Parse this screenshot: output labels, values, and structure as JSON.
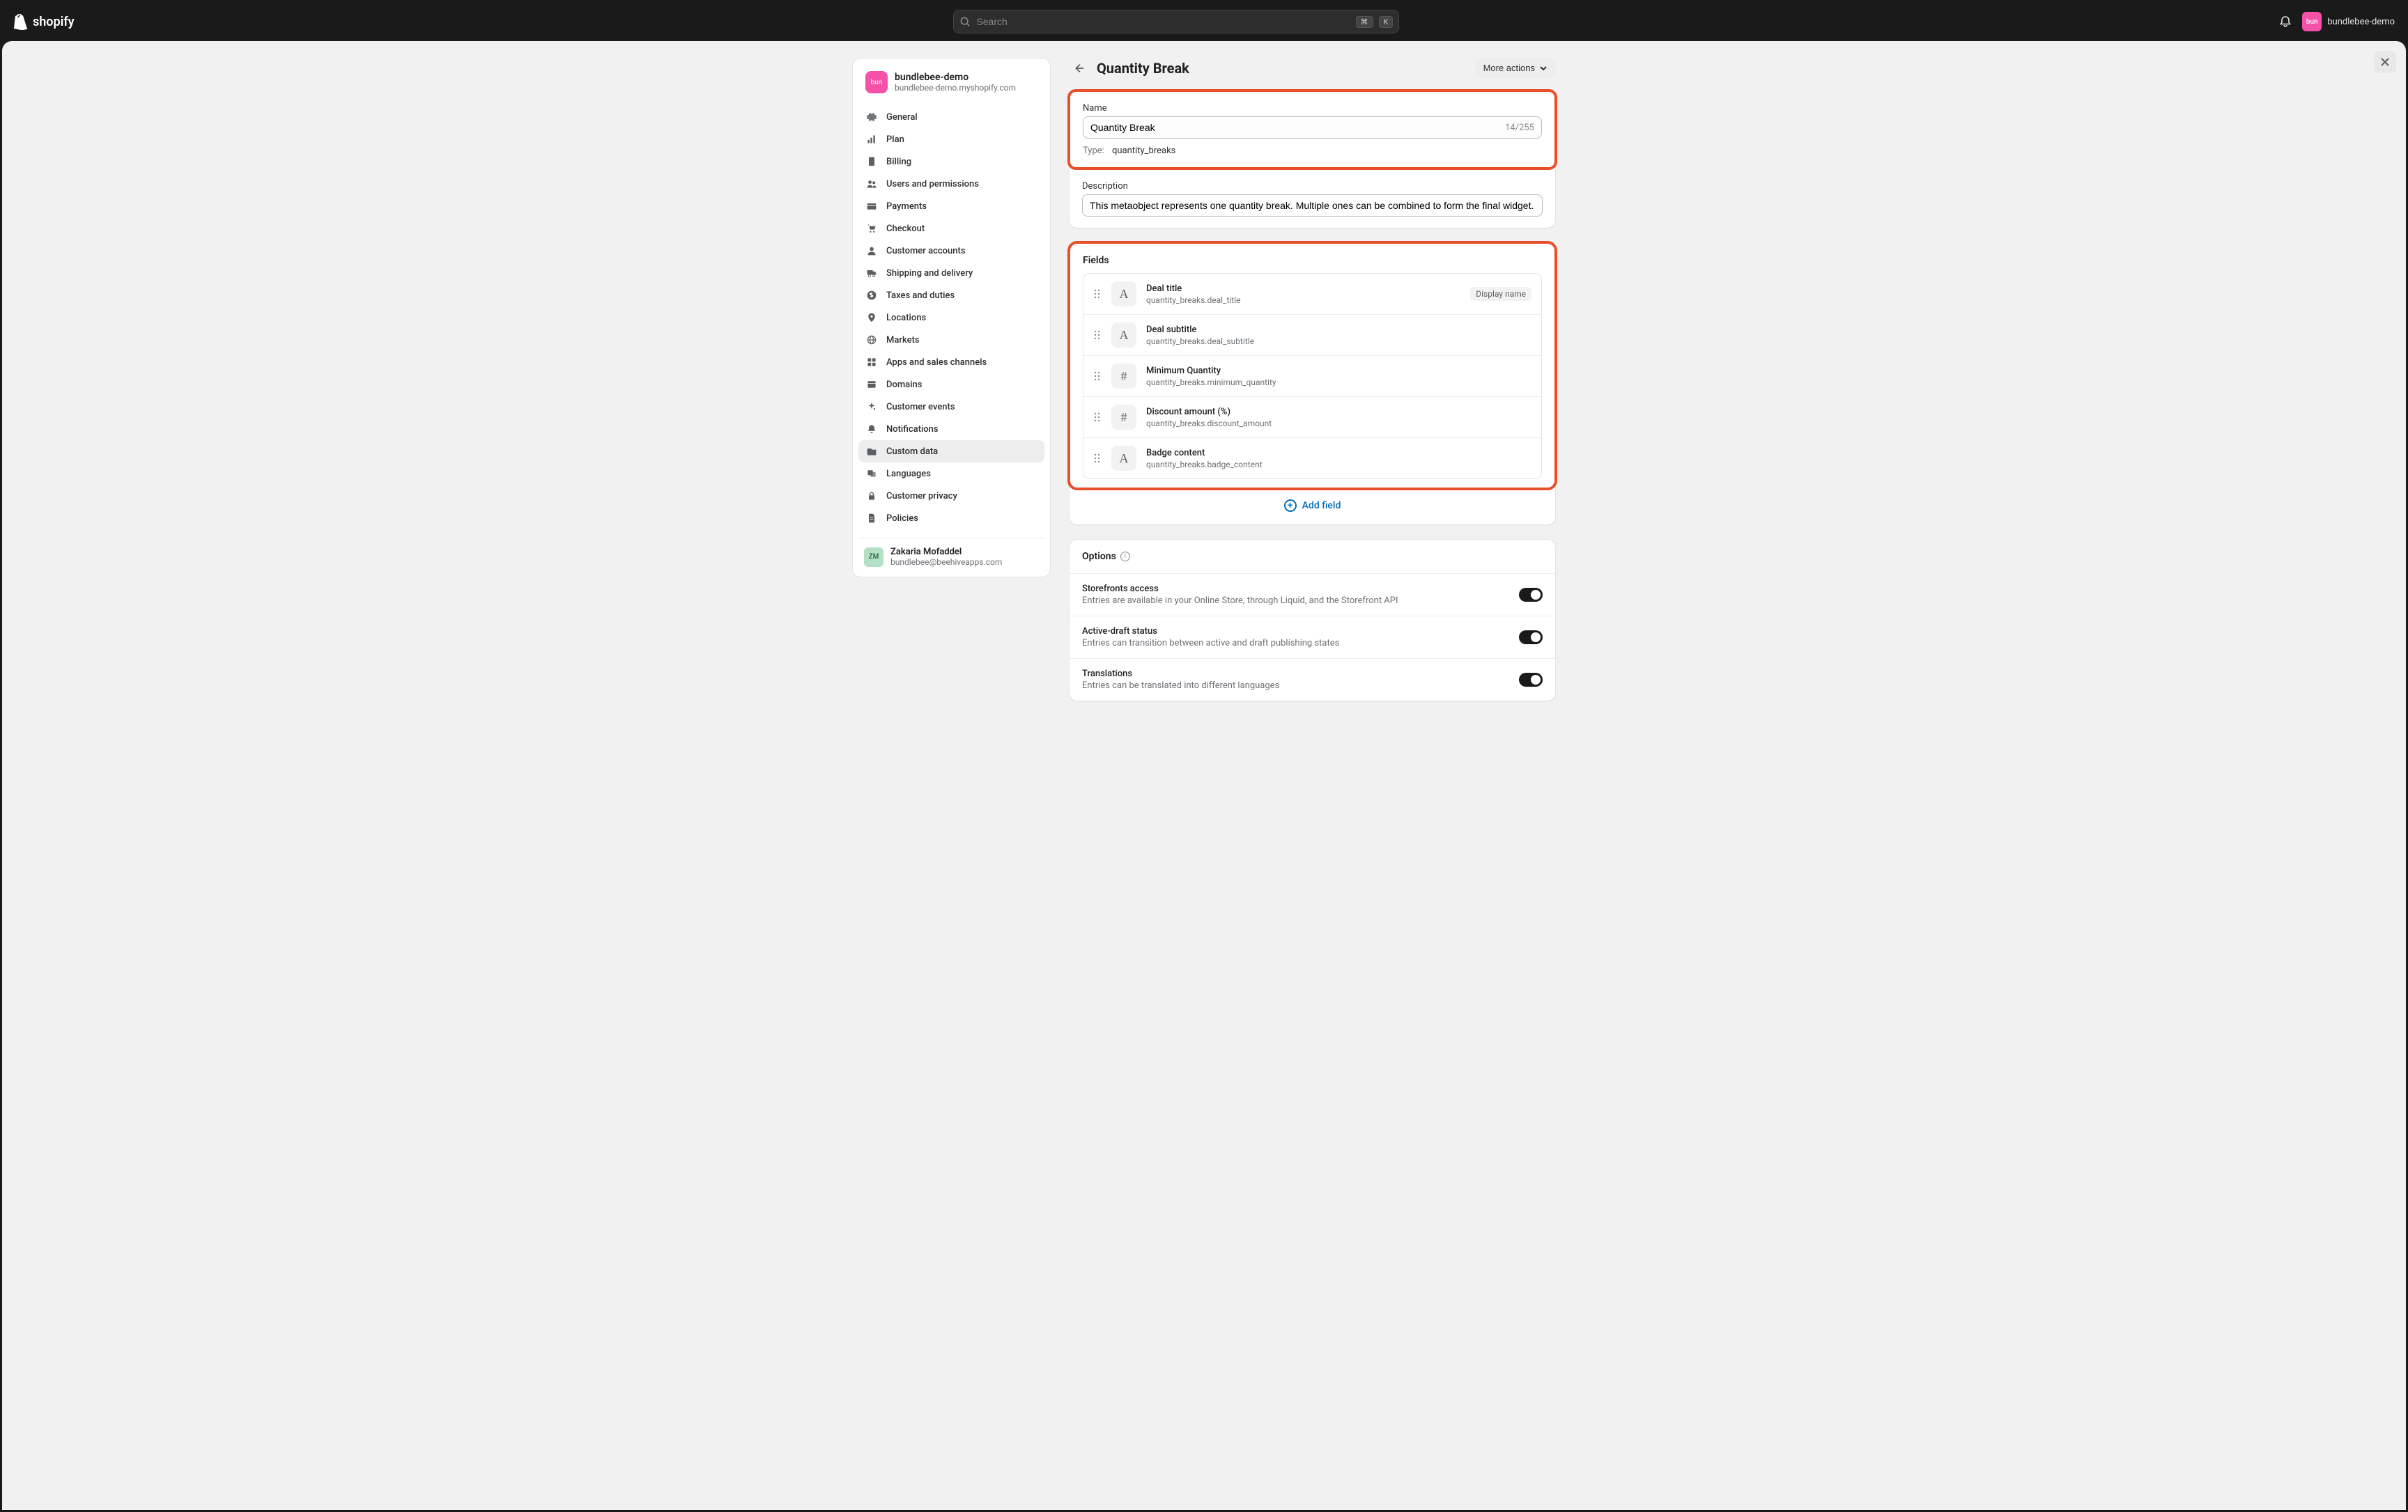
{
  "topbar": {
    "logo_text": "shopify",
    "search_placeholder": "Search",
    "kbd1": "⌘",
    "kbd2": "K",
    "store_label": "bundlebee-demo",
    "avatar_text": "bun"
  },
  "sidebar": {
    "store": {
      "avatar": "bun",
      "name": "bundlebee-demo",
      "domain": "bundlebee-demo.myshopify.com"
    },
    "items": [
      {
        "label": "General",
        "icon": "gear"
      },
      {
        "label": "Plan",
        "icon": "chart"
      },
      {
        "label": "Billing",
        "icon": "receipt"
      },
      {
        "label": "Users and permissions",
        "icon": "users"
      },
      {
        "label": "Payments",
        "icon": "card"
      },
      {
        "label": "Checkout",
        "icon": "cart"
      },
      {
        "label": "Customer accounts",
        "icon": "person"
      },
      {
        "label": "Shipping and delivery",
        "icon": "truck"
      },
      {
        "label": "Taxes and duties",
        "icon": "money"
      },
      {
        "label": "Locations",
        "icon": "pin"
      },
      {
        "label": "Markets",
        "icon": "globe"
      },
      {
        "label": "Apps and sales channels",
        "icon": "apps"
      },
      {
        "label": "Domains",
        "icon": "domain"
      },
      {
        "label": "Customer events",
        "icon": "sparkle"
      },
      {
        "label": "Notifications",
        "icon": "bell"
      },
      {
        "label": "Custom data",
        "icon": "folder",
        "active": true
      },
      {
        "label": "Languages",
        "icon": "lang"
      },
      {
        "label": "Customer privacy",
        "icon": "lock"
      },
      {
        "label": "Policies",
        "icon": "doc"
      }
    ],
    "user": {
      "initials": "ZM",
      "name": "Zakaria Mofaddel",
      "email": "bundlebee@beehiveapps.com"
    }
  },
  "page": {
    "title": "Quantity Break",
    "more_actions": "More actions"
  },
  "name_card": {
    "label": "Name",
    "value": "Quantity Break",
    "counter": "14/255",
    "type_label": "Type:",
    "type_value": "quantity_breaks"
  },
  "description_card": {
    "label": "Description",
    "value": "This metaobject represents one quantity break. Multiple ones can be combined to form the final widget."
  },
  "fields_card": {
    "title": "Fields",
    "rows": [
      {
        "icon": "A",
        "name": "Deal title",
        "key": "quantity_breaks.deal_title",
        "badge": "Display name"
      },
      {
        "icon": "A",
        "name": "Deal subtitle",
        "key": "quantity_breaks.deal_subtitle"
      },
      {
        "icon": "#",
        "name": "Minimum Quantity",
        "key": "quantity_breaks.minimum_quantity"
      },
      {
        "icon": "#",
        "name": "Discount amount (%)",
        "key": "quantity_breaks.discount_amount"
      },
      {
        "icon": "A",
        "name": "Badge content",
        "key": "quantity_breaks.badge_content"
      }
    ],
    "add_label": "Add field"
  },
  "options_card": {
    "title": "Options",
    "rows": [
      {
        "title": "Storefronts access",
        "sub": "Entries are available in your Online Store, through Liquid, and the Storefront API",
        "on": true
      },
      {
        "title": "Active-draft status",
        "sub": "Entries can transition between active and draft publishing states",
        "on": true
      },
      {
        "title": "Translations",
        "sub": "Entries can be translated into different languages",
        "on": true
      }
    ]
  }
}
